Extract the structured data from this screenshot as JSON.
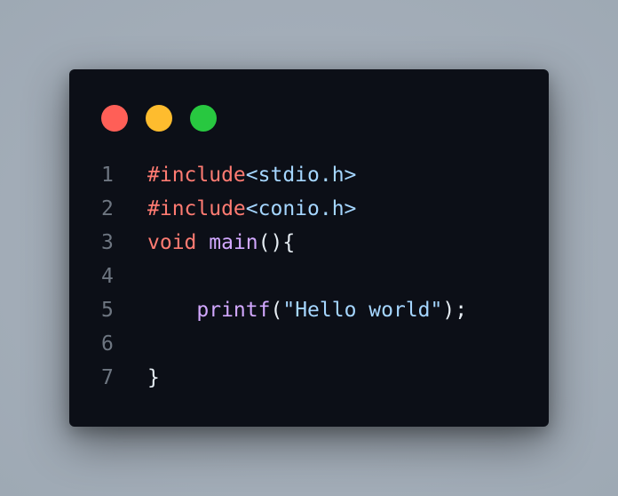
{
  "colors": {
    "close": "#ff5f57",
    "minimize": "#febc2e",
    "maximize": "#28c840",
    "background": "#0c0f17",
    "keyword": "#ff7b72",
    "function": "#d2a8ff",
    "string": "#a5d6ff",
    "line_number": "#6e7681"
  },
  "window_controls": {
    "close": "close-icon",
    "minimize": "minimize-icon",
    "maximize": "maximize-icon"
  },
  "code": {
    "lines": [
      {
        "number": "1",
        "tokens": [
          {
            "type": "keyword",
            "text": "#include"
          },
          {
            "type": "header",
            "text": "<stdio.h>"
          }
        ]
      },
      {
        "number": "2",
        "tokens": [
          {
            "type": "keyword",
            "text": "#include"
          },
          {
            "type": "header",
            "text": "<conio.h>"
          }
        ]
      },
      {
        "number": "3",
        "tokens": [
          {
            "type": "keyword",
            "text": "void"
          },
          {
            "type": "punct",
            "text": " "
          },
          {
            "type": "func",
            "text": "main"
          },
          {
            "type": "punct",
            "text": "(){"
          }
        ]
      },
      {
        "number": "4",
        "tokens": []
      },
      {
        "number": "5",
        "tokens": [
          {
            "type": "punct",
            "text": "    "
          },
          {
            "type": "func",
            "text": "printf"
          },
          {
            "type": "punct",
            "text": "("
          },
          {
            "type": "string",
            "text": "\"Hello world\""
          },
          {
            "type": "punct",
            "text": ");"
          }
        ]
      },
      {
        "number": "6",
        "tokens": []
      },
      {
        "number": "7",
        "tokens": [
          {
            "type": "punct",
            "text": "}"
          }
        ]
      }
    ]
  }
}
